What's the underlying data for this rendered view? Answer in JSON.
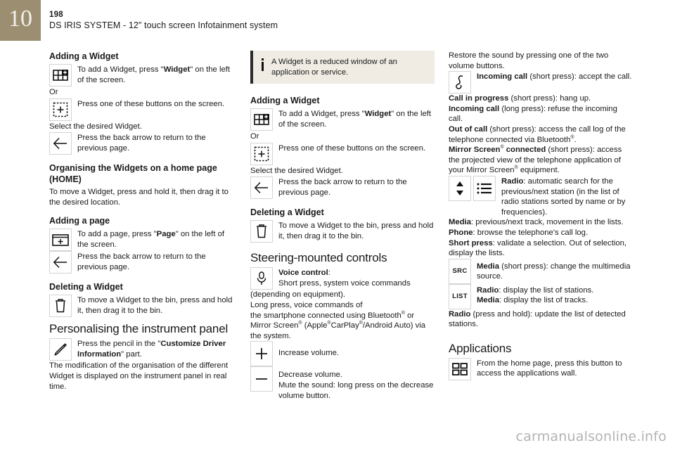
{
  "header": {
    "chapter": "10",
    "page_number": "198",
    "title": "DS IRIS SYSTEM - 12\" touch screen Infotainment system"
  },
  "watermark": "carmanualsonline.info",
  "colors": {
    "chapter_tab": "#9c8f71",
    "info_box_bg": "#f0ece4",
    "info_box_border": "#2b2b2b",
    "text": "#1a1a1a",
    "icon_border": "#d3d3d3",
    "watermark": "#b3b3b3"
  },
  "column1": {
    "heading_adding_widget": "Adding a Widget",
    "widget_icon_text_a": "To add a Widget, press \"",
    "widget_icon_text_b": "Widget",
    "widget_icon_text_c": "\" on the left of the screen.",
    "or_label": "Or",
    "plus_button_text": "Press one of these buttons on the screen.",
    "select_desired": "Select the desired Widget.",
    "back_arrow_text": "Press the back arrow to return to the previous page.",
    "heading_organising": "Organising the Widgets on a home page (HOME)",
    "organising_text": "To move a Widget, press and hold it, then drag it to the desired location.",
    "heading_adding_page": "Adding a page",
    "add_page_text_a": "To add a page, press \"",
    "add_page_text_b": "Page",
    "add_page_text_c": "\" on the left of the screen.",
    "back_arrow_text_2": "Press the back arrow to return to the previous page.",
    "heading_deleting_widget": "Deleting a Widget",
    "deleting_text": "To move a Widget to the bin, press and hold it, then drag it to the bin.",
    "heading_personalising": "Personalising the instrument panel",
    "pencil_text_a": "Press the pencil in the \"",
    "pencil_text_b": "Customize Driver Information",
    "pencil_text_c": "\" part.",
    "modification_text": "The modification of the organisation of the different Widget is displayed on the instrument panel in real time."
  },
  "column2": {
    "info_note": "A Widget is a reduced window of an application or service.",
    "heading_adding_widget": "Adding a Widget",
    "widget_icon_text_a": "To add a Widget, press \"",
    "widget_icon_text_b": "Widget",
    "widget_icon_text_c": "\" on the left of the screen.",
    "or_label": "Or",
    "plus_button_text": "Press one of these buttons on the screen.",
    "select_desired": "Select the desired Widget.",
    "back_arrow_text": "Press the back arrow to return to the previous page.",
    "heading_deleting_widget": "Deleting a Widget",
    "deleting_text": "To move a Widget to the bin, press and hold it, then drag it to the bin.",
    "heading_steering": "Steering-mounted controls",
    "voice_control_label": "Voice control",
    "voice_control_colon": ":",
    "voice_short_press": "Short press, system voice commands",
    "voice_depending": "(depending on equipment).",
    "voice_long_press_1": "Long press, voice commands of",
    "voice_long_press_2a": "the smartphone connected using Bluetooth",
    "voice_long_press_2b": "®",
    "voice_long_press_2c": " or",
    "voice_long_press_3a": "Mirror Screen",
    "voice_long_press_3b": "®",
    "voice_long_press_3c": " (Apple",
    "voice_long_press_3d": "®",
    "voice_long_press_3e": "CarPlay",
    "voice_long_press_3f": "®",
    "voice_long_press_3g": "/Android Auto) via",
    "voice_long_press_4": "the system.",
    "increase_volume": "Increase volume.",
    "decrease_volume": "Decrease volume.",
    "mute_text": "Mute the sound: long press on the decrease volume button."
  },
  "column3": {
    "restore_sound": "Restore the sound by pressing one of the two volume buttons.",
    "incoming_call_label": "Incoming call",
    "incoming_call_text": " (short press): accept the call.",
    "call_in_progress_label": "Call in progress",
    "call_in_progress_text": " (short press): hang up.",
    "incoming_call_long_label": "Incoming call",
    "incoming_call_long_text": " (long press): refuse the incoming call.",
    "out_of_call_label": "Out of call",
    "out_of_call_text_a": " (short press): access the call log of the telephone connected via Bluetooth",
    "out_of_call_sup": "®",
    "out_of_call_text_b": ".",
    "mirror_label_a": "Mirror Screen",
    "mirror_label_sup": "®",
    "mirror_label_b": " connected",
    "mirror_text_a": " (short press): access the projected view of the telephone application of your Mirror Screen",
    "mirror_sup2": "®",
    "mirror_text_b": " equipment.",
    "radio_label": "Radio",
    "radio_text": ": automatic search for the previous/next station (in the list of radio stations sorted by name or by frequencies).",
    "media_label": "Media",
    "media_text": ": previous/next track, movement in the lists.",
    "phone_label": "Phone",
    "phone_text": ": browse the telephone's call log.",
    "short_press_label": "Short press",
    "short_press_text": ": validate a selection. Out of selection, display the lists.",
    "src_button_label": "SRC",
    "src_media_label": "Media",
    "src_media_text": " (short press): change the multimedia source.",
    "list_button_label": "LIST",
    "list_radio_label": "Radio",
    "list_radio_text": ": display the list of stations.",
    "list_media_label": "Media",
    "list_media_text": ": display the list of tracks.",
    "radio_hold_label": "Radio",
    "radio_hold_text": " (press and hold): update the list of detected stations.",
    "heading_applications": "Applications",
    "applications_text": "From the home page, press this button to access the applications wall."
  }
}
